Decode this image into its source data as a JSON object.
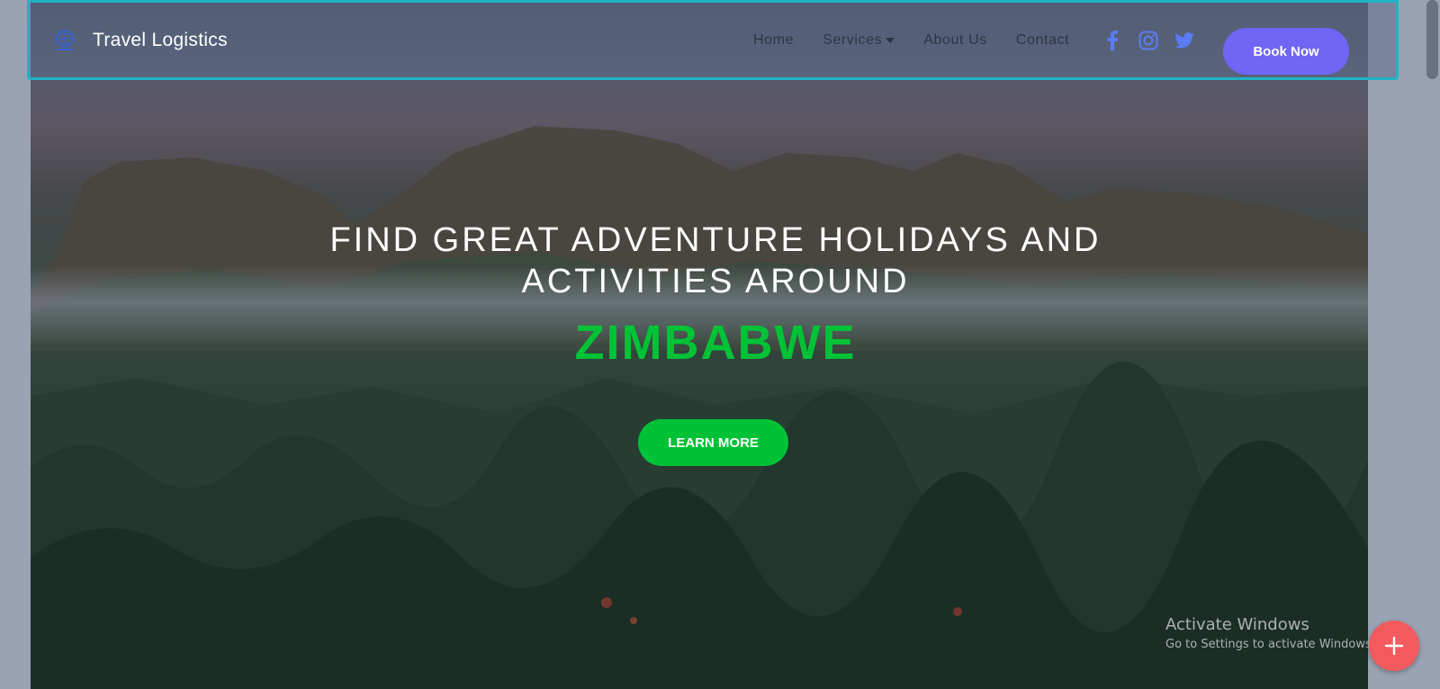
{
  "brand": {
    "name": "Travel Logistics",
    "logo_icon": "globe-icon"
  },
  "nav": {
    "items": [
      {
        "label": "Home"
      },
      {
        "label": "Services",
        "has_dropdown": true
      },
      {
        "label": "About Us"
      },
      {
        "label": "Contact"
      }
    ],
    "socials": [
      "facebook-icon",
      "instagram-icon",
      "twitter-icon"
    ],
    "book_label": "Book Now"
  },
  "hero": {
    "title_line1": "FIND GREAT ADVENTURE HOLIDAYS AND",
    "title_line2": "ACTIVITIES AROUND",
    "accent": "ZIMBABWE",
    "cta_label": "LEARN MORE"
  },
  "watermark": {
    "title": "Activate Windows",
    "subtitle": "Go to Settings to activate Windows."
  },
  "fab": {
    "icon": "plus-icon"
  },
  "colors": {
    "accent_purple": "#7065f5",
    "accent_green": "#00c236",
    "nav_border": "#1fb3c4",
    "social_blue": "#5b7cf5",
    "fab_red": "#f35a5d"
  }
}
